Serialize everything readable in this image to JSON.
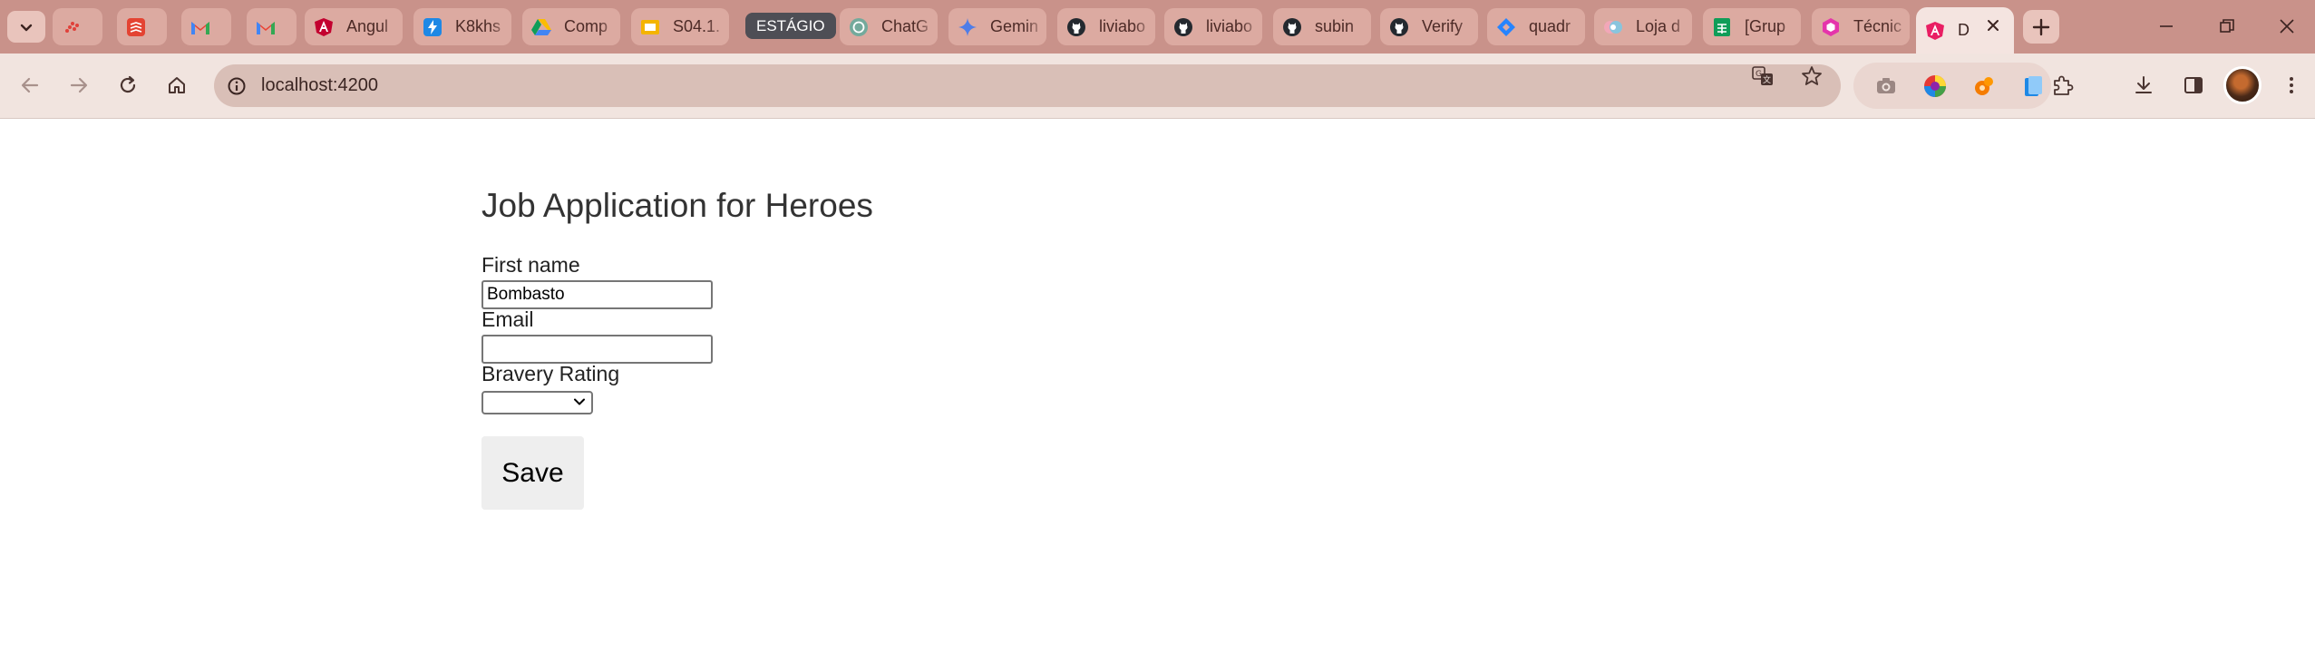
{
  "browser": {
    "tabs": [
      {
        "title": "",
        "icon": "red-dots-icon"
      },
      {
        "title": "",
        "icon": "todoist-icon"
      },
      {
        "title": "",
        "icon": "gmail-icon"
      },
      {
        "title": "",
        "icon": "gmail-icon"
      },
      {
        "title": "Angul",
        "icon": "angular-icon"
      },
      {
        "title": "K8khs",
        "icon": "lightning-icon"
      },
      {
        "title": "Comp",
        "icon": "google-drive-icon"
      },
      {
        "title": "S04.1.",
        "icon": "slides-icon"
      },
      {
        "title": "ChatG",
        "icon": "chatgpt-icon"
      },
      {
        "title": "Gemin",
        "icon": "gemini-icon"
      },
      {
        "title": "liviabo",
        "icon": "github-icon"
      },
      {
        "title": "liviabo",
        "icon": "github-icon"
      },
      {
        "title": "subin",
        "icon": "github-icon"
      },
      {
        "title": "Verify",
        "icon": "github-icon"
      },
      {
        "title": "quadr",
        "icon": "jira-icon"
      },
      {
        "title": "Loja d",
        "icon": "store-icon"
      },
      {
        "title": "[Grup",
        "icon": "sheets-icon"
      },
      {
        "title": "Técnic",
        "icon": "hexagon-icon"
      },
      {
        "title": "D",
        "icon": "angular-icon",
        "active": true
      }
    ],
    "tab_group_label": "ESTÁGIO",
    "url": "localhost:4200",
    "colors": {
      "frame": "#c9928a",
      "toolbar": "#f1e4df",
      "omnibox": "#d9bfb7"
    }
  },
  "form": {
    "title": "Job Application for Heroes",
    "first_name_label": "First name",
    "first_name_value": "Bombasto",
    "email_label": "Email",
    "email_value": "",
    "bravery_label": "Bravery Rating",
    "bravery_value": "",
    "save_label": "Save"
  }
}
